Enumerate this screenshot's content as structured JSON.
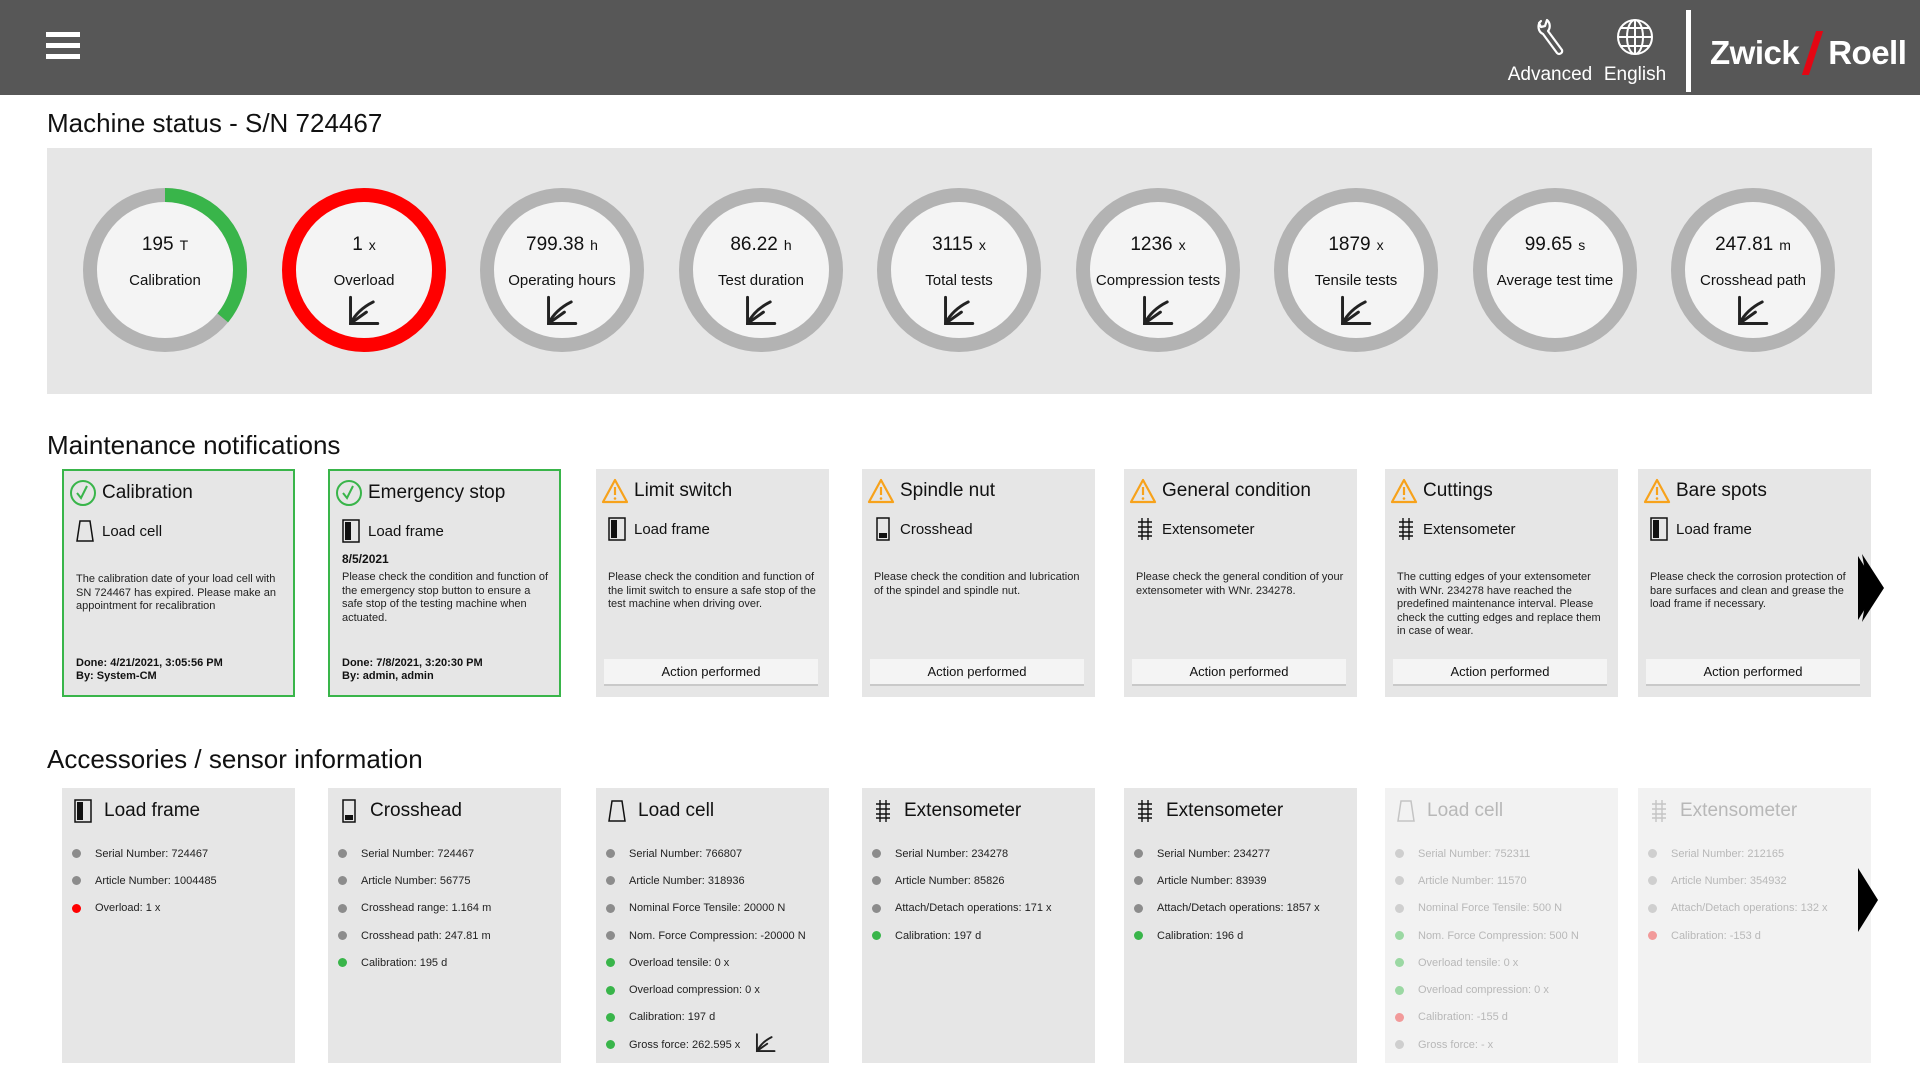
{
  "header": {
    "advanced_label": "Advanced",
    "language_label": "English",
    "logo_left": "Zwick",
    "logo_right": "Roell"
  },
  "machine_status": {
    "title": "Machine status -  S/N 724467",
    "gauges": [
      {
        "value": "195",
        "unit": "T",
        "label": "Calibration",
        "ring": "progress",
        "progress": 0.36,
        "color": "#39b54a",
        "chart_icon": false
      },
      {
        "value": "1",
        "unit": "x",
        "label": "Overload",
        "ring": "full",
        "color": "#ff0000",
        "chart_icon": true
      },
      {
        "value": "799.38",
        "unit": "h",
        "label": "Operating hours",
        "ring": "plain",
        "chart_icon": true
      },
      {
        "value": "86.22",
        "unit": "h",
        "label": "Test duration",
        "ring": "plain",
        "chart_icon": true
      },
      {
        "value": "3115",
        "unit": "x",
        "label": "Total tests",
        "ring": "plain",
        "chart_icon": true
      },
      {
        "value": "1236",
        "unit": "x",
        "label": "Compression tests",
        "ring": "plain",
        "chart_icon": true
      },
      {
        "value": "1879",
        "unit": "x",
        "label": "Tensile tests",
        "ring": "plain",
        "chart_icon": true
      },
      {
        "value": "99.65",
        "unit": "s",
        "label": "Average test time",
        "ring": "plain",
        "chart_icon": false
      },
      {
        "value": "247.81",
        "unit": "m",
        "label": "Crosshead path",
        "ring": "plain",
        "chart_icon": true
      }
    ]
  },
  "maintenance": {
    "title": "Maintenance notifications",
    "cards": [
      {
        "status": "ok",
        "title": "Calibration",
        "sub_icon": "load-cell",
        "subtitle": "Load cell",
        "date": "",
        "text": "The calibration date of your load cell with SN 724467 has expired. Please make an appointment for recalibration",
        "done": "Done: 4/21/2021, 3:05:56 PM",
        "by": "By: System-CM"
      },
      {
        "status": "ok",
        "title": "Emergency stop",
        "sub_icon": "load-frame",
        "subtitle": "Load frame",
        "date": "8/5/2021",
        "text": "Please check the condition and function of the emergency stop button to ensure a safe stop of the testing machine when actuated.",
        "done": "Done: 7/8/2021, 3:20:30 PM",
        "by": "By: admin, admin"
      },
      {
        "status": "warn",
        "title": "Limit switch",
        "sub_icon": "load-frame",
        "subtitle": "Load frame",
        "date": "",
        "text": "Please check the condition and function of the limit switch to ensure a safe stop of the test machine when driving over.",
        "button": "Action performed"
      },
      {
        "status": "warn",
        "title": "Spindle nut",
        "sub_icon": "crosshead",
        "subtitle": "Crosshead",
        "date": "",
        "text": "Please check the condition and lubrication of the spindel and spindle nut.",
        "button": "Action performed"
      },
      {
        "status": "warn",
        "title": "General condition",
        "sub_icon": "extensometer",
        "subtitle": "Extensometer",
        "date": "",
        "text": "Please check the general condition of your extensometer with WNr. 234278.",
        "button": "Action performed"
      },
      {
        "status": "warn",
        "title": "Cuttings",
        "sub_icon": "extensometer",
        "subtitle": "Extensometer",
        "date": "",
        "text": "The cutting edges of your extensometer with WNr. 234278 have reached the predefined maintenance interval. Please check the cutting edges and replace them in case of wear.",
        "button": "Action performed"
      },
      {
        "status": "warn",
        "title": "Bare spots",
        "sub_icon": "load-frame",
        "subtitle": "Load frame",
        "date": "",
        "text": "Please check the corrosion protection of bare surfaces and clean and grease the load frame if necessary.",
        "button": "Action performed"
      }
    ]
  },
  "accessories": {
    "title": "Accessories / sensor information",
    "cards": [
      {
        "icon": "load-frame",
        "title": "Load frame",
        "dim": false,
        "items": [
          {
            "text": "Serial Number: 724467",
            "dot": "grey"
          },
          {
            "text": "Article Number: 1004485",
            "dot": "grey"
          },
          {
            "text": "Overload: 1 x",
            "dot": "red"
          }
        ]
      },
      {
        "icon": "crosshead",
        "title": "Crosshead",
        "dim": false,
        "items": [
          {
            "text": "Serial Number: 724467",
            "dot": "grey"
          },
          {
            "text": "Article Number: 56775",
            "dot": "grey"
          },
          {
            "text": "Crosshead range: 1.164 m",
            "dot": "grey"
          },
          {
            "text": "Crosshead path: 247.81 m",
            "dot": "grey"
          },
          {
            "text": "Calibration: 195 d",
            "dot": "green"
          }
        ]
      },
      {
        "icon": "load-cell",
        "title": "Load cell",
        "dim": false,
        "items": [
          {
            "text": "Serial Number: 766807",
            "dot": "grey"
          },
          {
            "text": "Article Number: 318936",
            "dot": "grey"
          },
          {
            "text": "Nominal Force Tensile: 20000 N",
            "dot": "grey"
          },
          {
            "text": "Nom. Force Compression: -20000 N",
            "dot": "grey"
          },
          {
            "text": "Overload tensile: 0 x",
            "dot": "green"
          },
          {
            "text": "Overload compression: 0 x",
            "dot": "green"
          },
          {
            "text": "Calibration: 197 d",
            "dot": "green"
          },
          {
            "text": "Gross force: 262.595 x",
            "dot": "green",
            "chart_icon": true
          }
        ]
      },
      {
        "icon": "extensometer",
        "title": "Extensometer",
        "dim": false,
        "items": [
          {
            "text": "Serial Number: 234278",
            "dot": "grey"
          },
          {
            "text": "Article Number: 85826",
            "dot": "grey"
          },
          {
            "text": "Attach/Detach operations: 171 x",
            "dot": "grey"
          },
          {
            "text": "Calibration: 197 d",
            "dot": "green"
          }
        ]
      },
      {
        "icon": "extensometer",
        "title": "Extensometer",
        "dim": false,
        "items": [
          {
            "text": "Serial Number: 234277",
            "dot": "grey"
          },
          {
            "text": "Article Number: 83939",
            "dot": "grey"
          },
          {
            "text": "Attach/Detach operations: 1857 x",
            "dot": "grey"
          },
          {
            "text": "Calibration: 196 d",
            "dot": "green"
          }
        ]
      },
      {
        "icon": "load-cell",
        "title": "Load cell",
        "dim": true,
        "items": [
          {
            "text": "Serial Number: 752311",
            "dot": "grey"
          },
          {
            "text": "Article Number: 11570",
            "dot": "grey"
          },
          {
            "text": "Nominal Force Tensile: 500 N",
            "dot": "grey"
          },
          {
            "text": "Nom. Force Compression: 500 N",
            "dot": "green"
          },
          {
            "text": "Overload tensile: 0 x",
            "dot": "green"
          },
          {
            "text": "Overload compression: 0 x",
            "dot": "green"
          },
          {
            "text": "Calibration: -155 d",
            "dot": "red"
          },
          {
            "text": "Gross force: - x",
            "dot": "grey"
          }
        ]
      },
      {
        "icon": "extensometer",
        "title": "Extensometer",
        "dim": true,
        "items": [
          {
            "text": "Serial Number: 212165",
            "dot": "grey"
          },
          {
            "text": "Article Number: 354932",
            "dot": "grey"
          },
          {
            "text": "Attach/Detach operations: 132 x",
            "dot": "grey"
          },
          {
            "text": "Calibration: -153 d",
            "dot": "red"
          }
        ]
      }
    ]
  },
  "colors": {
    "header_bg": "#575757",
    "panel_bg": "#e6e6e6",
    "ok_green": "#39b54a",
    "warn_orange": "#f7a21b",
    "alert_red": "#ff0000",
    "ring_grey": "#b3b3b3"
  }
}
